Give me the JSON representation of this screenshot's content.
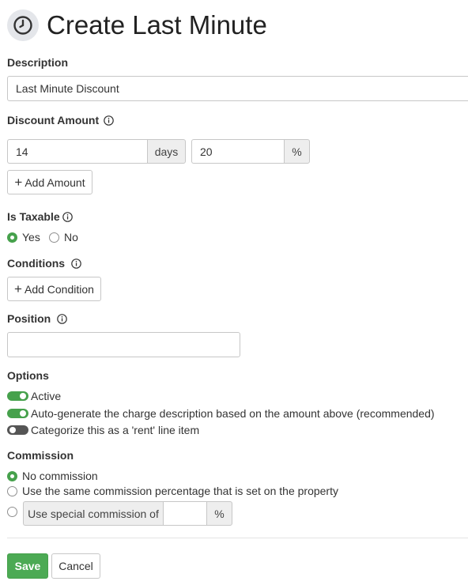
{
  "page": {
    "title": "Create Last Minute",
    "icon": "clock-icon"
  },
  "description": {
    "label": "Description",
    "value": "Last Minute Discount"
  },
  "discount_amount": {
    "label": "Discount Amount",
    "days_value": "14",
    "days_addon": "days",
    "percent_value": "20",
    "percent_addon": "%",
    "add_button": "Add Amount"
  },
  "is_taxable": {
    "label": "Is Taxable",
    "yes_label": "Yes",
    "no_label": "No",
    "selected": "Yes"
  },
  "conditions": {
    "label": "Conditions",
    "add_button": "Add Condition"
  },
  "position": {
    "label": "Position",
    "value": ""
  },
  "options": {
    "label": "Options",
    "items": [
      {
        "label": "Active",
        "enabled": true
      },
      {
        "label": "Auto-generate the charge description based on the amount above (recommended)",
        "enabled": true
      },
      {
        "label": "Categorize this as a 'rent' line item",
        "enabled": false
      }
    ]
  },
  "commission": {
    "label": "Commission",
    "option_none": "No commission",
    "option_same": "Use the same commission percentage that is set on the property",
    "option_special_prefix": "Use special commission of",
    "option_special_suffix": "%",
    "special_value": "",
    "selected": "No commission"
  },
  "actions": {
    "save_label": "Save",
    "cancel_label": "Cancel"
  },
  "colors": {
    "accent": "#4caa54",
    "toggle_off": "#555555"
  }
}
